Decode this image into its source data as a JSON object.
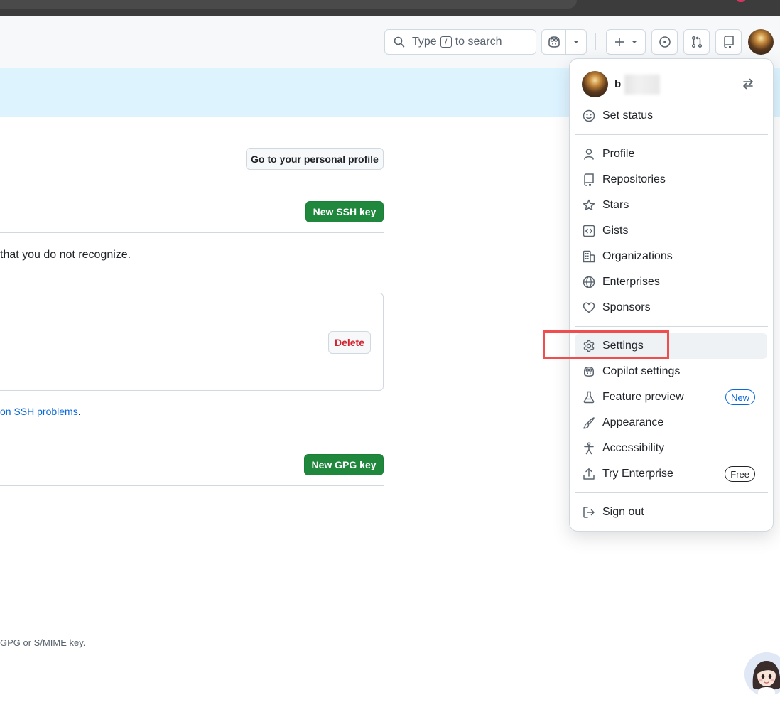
{
  "header": {
    "search": {
      "type_text": "Type",
      "slash_key": "/",
      "suffix_text": "to search"
    },
    "icons": {
      "search": "search-icon",
      "copilot": "copilot-icon",
      "chevron": "chevron-down-icon",
      "plus": "plus-icon",
      "issues": "issue-opened-icon",
      "pulls": "git-pull-request-icon",
      "inbox": "repo-icon"
    }
  },
  "main": {
    "profile_button": "Go to your personal profile",
    "new_ssh_button": "New SSH key",
    "ssh_notice_fragment": "that you do not recognize.",
    "delete_button": "Delete",
    "ssh_help_link": "on SSH problems",
    "ssh_help_period": ".",
    "new_gpg_button": "New GPG key",
    "gpg_footer_fragment": "GPG or S/MIME key."
  },
  "menu": {
    "username": "b",
    "items": [
      {
        "label": "Set status",
        "icon": "smiley-icon"
      },
      {
        "label": "Profile",
        "icon": "person-icon"
      },
      {
        "label": "Repositories",
        "icon": "repo-icon"
      },
      {
        "label": "Stars",
        "icon": "star-icon"
      },
      {
        "label": "Gists",
        "icon": "code-square-icon"
      },
      {
        "label": "Organizations",
        "icon": "organization-icon"
      },
      {
        "label": "Enterprises",
        "icon": "globe-icon"
      },
      {
        "label": "Sponsors",
        "icon": "heart-icon"
      },
      {
        "label": "Settings",
        "icon": "gear-icon"
      },
      {
        "label": "Copilot settings",
        "icon": "copilot-icon"
      },
      {
        "label": "Feature preview",
        "icon": "beaker-icon",
        "badge": "New"
      },
      {
        "label": "Appearance",
        "icon": "paintbrush-icon"
      },
      {
        "label": "Accessibility",
        "icon": "accessibility-icon"
      },
      {
        "label": "Try Enterprise",
        "icon": "upload-icon",
        "badge": "Free"
      },
      {
        "label": "Sign out",
        "icon": "sign-out-icon"
      }
    ]
  },
  "colors": {
    "primary_button": "#1f883d",
    "danger": "#d1242f",
    "link": "#0969da",
    "banner": "#ddf4ff",
    "highlight": "#f04e4e"
  }
}
